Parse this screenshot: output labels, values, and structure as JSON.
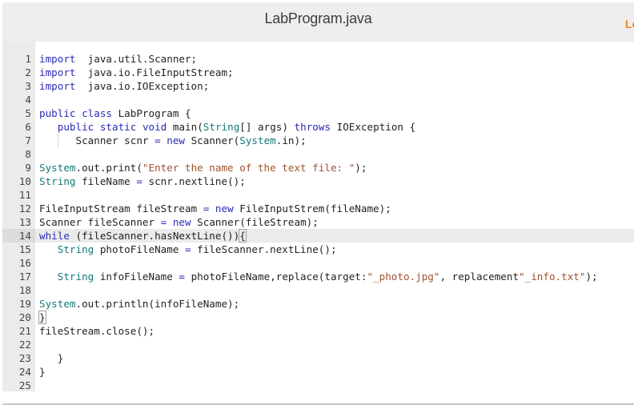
{
  "header": {
    "title": "LabProgram.java",
    "side_link_partial": "Lo",
    "side_link_color": "#f2811d"
  },
  "editor": {
    "language": "java",
    "active_line": 14,
    "lines": [
      {
        "n": "1",
        "tokens": [
          [
            "kw",
            "import"
          ],
          [
            "",
            "  java.util.Scanner;"
          ]
        ]
      },
      {
        "n": "2",
        "tokens": [
          [
            "kw",
            "import"
          ],
          [
            "",
            "  java.io.FileInputStream;"
          ]
        ]
      },
      {
        "n": "3",
        "tokens": [
          [
            "kw",
            "import"
          ],
          [
            "",
            "  java.io.IOException;"
          ]
        ]
      },
      {
        "n": "4",
        "tokens": []
      },
      {
        "n": "5",
        "tokens": [
          [
            "kw",
            "public"
          ],
          [
            "",
            " "
          ],
          [
            "kw",
            "class"
          ],
          [
            "",
            " LabProgram {"
          ]
        ]
      },
      {
        "n": "6",
        "tokens": [
          [
            "",
            "   "
          ],
          [
            "kw",
            "public"
          ],
          [
            "",
            " "
          ],
          [
            "kw",
            "static"
          ],
          [
            "",
            " "
          ],
          [
            "kw",
            "void"
          ],
          [
            "",
            " main("
          ],
          [
            "ty",
            "String"
          ],
          [
            "",
            "[] args) "
          ],
          [
            "kw",
            "throws"
          ],
          [
            "",
            " IOException {"
          ]
        ]
      },
      {
        "n": "7",
        "tokens": [
          [
            "",
            "      Scanner scnr "
          ],
          [
            "op",
            "="
          ],
          [
            "",
            " "
          ],
          [
            "kw",
            "new"
          ],
          [
            "",
            " Scanner("
          ],
          [
            "ty",
            "System"
          ],
          [
            "",
            ".in);"
          ]
        ]
      },
      {
        "n": "8",
        "tokens": []
      },
      {
        "n": "9",
        "tokens": [
          [
            "ty",
            "System"
          ],
          [
            "",
            ".out.print("
          ],
          [
            "str",
            "\"Enter the name of the text file: \""
          ],
          [
            "",
            ");"
          ]
        ]
      },
      {
        "n": "10",
        "tokens": [
          [
            "ty",
            "String"
          ],
          [
            "",
            " fileName "
          ],
          [
            "op",
            "="
          ],
          [
            "",
            " scnr.nextline();"
          ]
        ]
      },
      {
        "n": "11",
        "tokens": []
      },
      {
        "n": "12",
        "tokens": [
          [
            "",
            "FileInputStream fileStream "
          ],
          [
            "op",
            "="
          ],
          [
            "",
            " "
          ],
          [
            "kw",
            "new"
          ],
          [
            "",
            " FileInputStrem(fileName);"
          ]
        ]
      },
      {
        "n": "13",
        "tokens": [
          [
            "",
            "Scanner fileScanner "
          ],
          [
            "op",
            "="
          ],
          [
            "",
            " "
          ],
          [
            "kw",
            "new"
          ],
          [
            "",
            " Scanner(fileStream);"
          ]
        ]
      },
      {
        "n": "14",
        "tokens": [
          [
            "kw",
            "while"
          ],
          [
            "",
            " (fileScanner.hasNextLine())"
          ],
          [
            "match",
            "{"
          ]
        ]
      },
      {
        "n": "15",
        "tokens": [
          [
            "",
            "   "
          ],
          [
            "ty",
            "String"
          ],
          [
            "",
            " photoFileName "
          ],
          [
            "op",
            "="
          ],
          [
            "",
            " fileScanner.nextLine();"
          ]
        ]
      },
      {
        "n": "16",
        "tokens": []
      },
      {
        "n": "17",
        "tokens": [
          [
            "",
            "   "
          ],
          [
            "ty",
            "String"
          ],
          [
            "",
            " infoFileName "
          ],
          [
            "op",
            "="
          ],
          [
            "",
            " photoFileName,replace(target:"
          ],
          [
            "str",
            "\"_photo.jpg\""
          ],
          [
            "",
            ", replacement"
          ],
          [
            "str",
            "\"_info.txt\""
          ],
          [
            "",
            ");"
          ]
        ]
      },
      {
        "n": "18",
        "tokens": []
      },
      {
        "n": "19",
        "tokens": [
          [
            "ty",
            "System"
          ],
          [
            "",
            ".out.println(infoFileName);"
          ]
        ]
      },
      {
        "n": "20",
        "tokens": [
          [
            "match",
            "}"
          ]
        ]
      },
      {
        "n": "21",
        "tokens": [
          [
            "",
            "fileStream.close();"
          ]
        ]
      },
      {
        "n": "22",
        "tokens": []
      },
      {
        "n": "23",
        "tokens": [
          [
            "",
            "   }"
          ]
        ]
      },
      {
        "n": "24",
        "tokens": [
          [
            "",
            "}"
          ]
        ]
      },
      {
        "n": "25",
        "tokens": []
      }
    ]
  }
}
